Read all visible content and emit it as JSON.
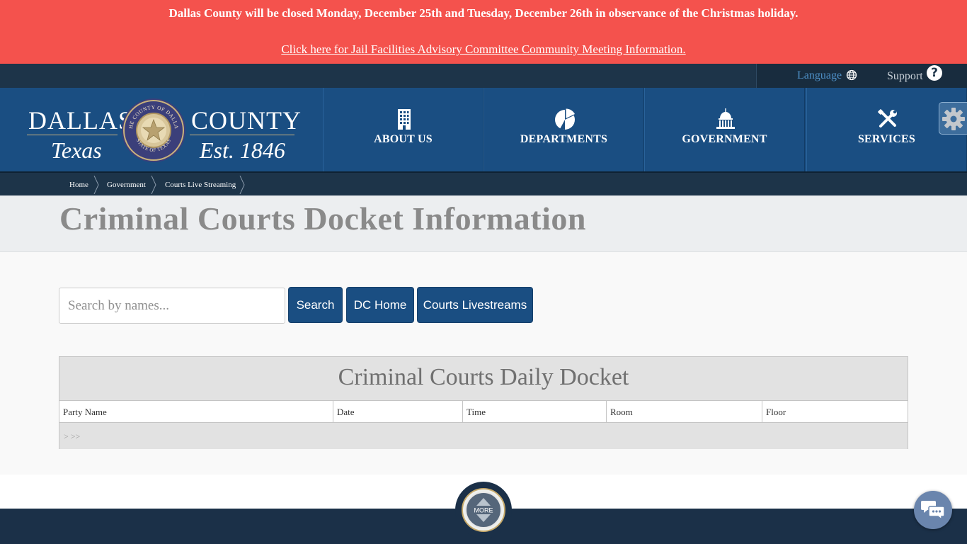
{
  "alert": {
    "message": "Dallas County will be closed Monday, December 25th and Tuesday, December 26th in observance of the Christmas holiday.",
    "link": "Click here for Jail Facilities Advisory Committee Community Meeting Information."
  },
  "utility": {
    "language": "Language",
    "support": "Support",
    "support_icon": "?"
  },
  "logo": {
    "dallas": "DALLAS",
    "county": "COUNTY",
    "texas": "Texas",
    "est": "Est. 1846",
    "seal_top": "THE COUNTY OF DALLAS",
    "seal_bottom": "STATE OF TEXAS"
  },
  "nav": [
    {
      "label": "ABOUT US",
      "icon": "building-icon"
    },
    {
      "label": "DEPARTMENTS",
      "icon": "pie-chart-icon"
    },
    {
      "label": "GOVERNMENT",
      "icon": "capitol-icon"
    },
    {
      "label": "SERVICES",
      "icon": "tools-icon"
    }
  ],
  "breadcrumb": [
    "Home",
    "Government",
    "Courts Live Streaming"
  ],
  "page": {
    "title": "Criminal Courts Docket Information"
  },
  "search": {
    "placeholder": "Search by names...",
    "value": ""
  },
  "buttons": {
    "search": "Search",
    "dc_home": "DC Home",
    "livestreams": "Courts Livestreams"
  },
  "docket": {
    "caption": "Criminal Courts Daily Docket",
    "columns": [
      "Party Name",
      "Date",
      "Time",
      "Room",
      "Floor"
    ],
    "pager": "> >>"
  },
  "more": {
    "label": "MORE"
  },
  "colors": {
    "alert": "#f4524d",
    "brand_blue": "#1a4e82",
    "dark_navy": "#1d3449"
  }
}
